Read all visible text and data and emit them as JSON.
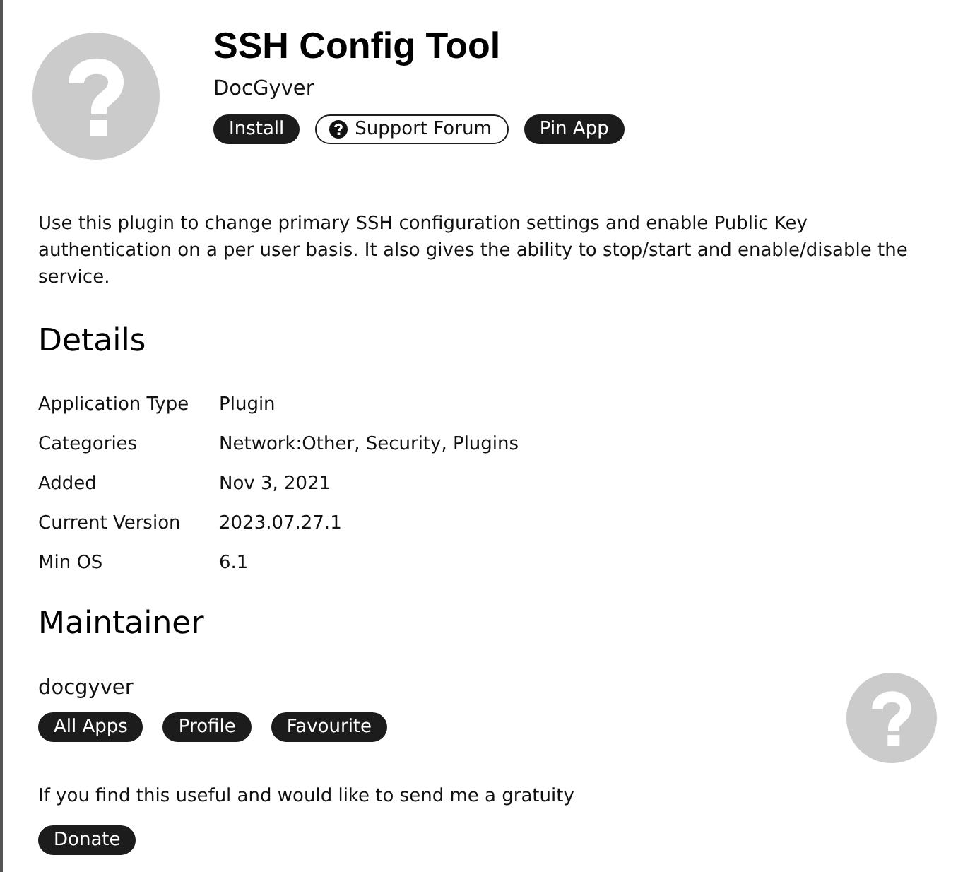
{
  "app": {
    "name": "SSH Config Tool",
    "author": "DocGyver",
    "actions": [
      {
        "label": "Install",
        "kind": "solid"
      },
      {
        "label": "Support Forum",
        "kind": "help-link"
      },
      {
        "label": "Pin App",
        "kind": "solid"
      }
    ]
  },
  "description": "Use this plugin to change primary SSH configuration settings and enable Public Key authentication on a per user basis. It also gives the ability to stop/start and enable/disable the service.",
  "details": {
    "heading": "Details",
    "rows": [
      {
        "label": "Application Type",
        "value": "Plugin"
      },
      {
        "label": "Categories",
        "value": "Network:Other, Security, Plugins"
      },
      {
        "label": "Added",
        "value": "Nov 3, 2021"
      },
      {
        "label": "Current Version",
        "value": "2023.07.27.1"
      },
      {
        "label": "Min OS",
        "value": "6.1"
      }
    ]
  },
  "maintainer": {
    "heading": "Maintainer",
    "name": "docgyver",
    "actions": [
      {
        "label": "All Apps",
        "kind": "solid"
      },
      {
        "label": "Profile",
        "kind": "solid"
      },
      {
        "label": "Favourite",
        "kind": "solid"
      }
    ],
    "donation_note": "If you find this useful and would like to send me a gratuity",
    "donate_button": "Donate"
  }
}
